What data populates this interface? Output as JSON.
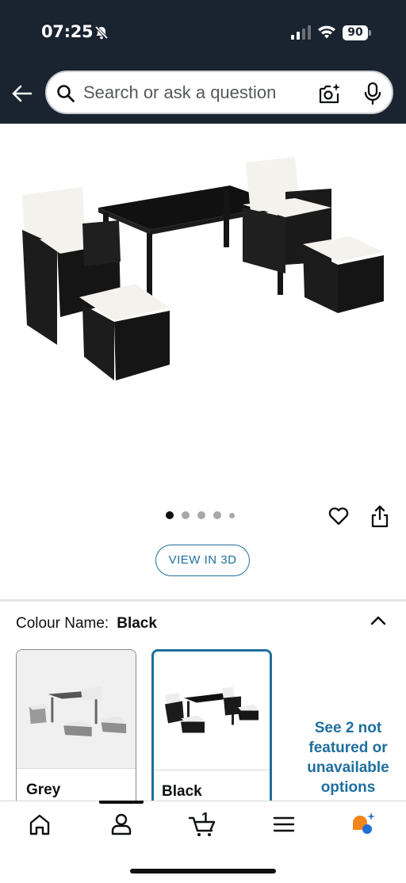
{
  "status_bar": {
    "time": "07:25",
    "battery": "90"
  },
  "search": {
    "placeholder": "Search or ask a question"
  },
  "carousel": {
    "total_images": 5,
    "active_index": 0
  },
  "view3d": {
    "label": "VIEW IN 3D"
  },
  "colour": {
    "label": "Colour Name:",
    "value": "Black"
  },
  "swatches": [
    {
      "name": "Grey"
    },
    {
      "name": "Black"
    }
  ],
  "see_more": {
    "text": "See 2 not featured or unavailable options"
  },
  "cart": {
    "count": "1"
  },
  "colors": {
    "header_bg": "#1a2330",
    "link_blue": "#1f6f9e",
    "selected_border": "#1f6f9e"
  },
  "icons": [
    "back-arrow-icon",
    "search-icon",
    "camera-sparkle-icon",
    "mic-icon",
    "heart-icon",
    "share-icon",
    "chevron-up-icon",
    "home-icon",
    "account-icon",
    "cart-icon",
    "menu-icon",
    "assistant-icon"
  ]
}
